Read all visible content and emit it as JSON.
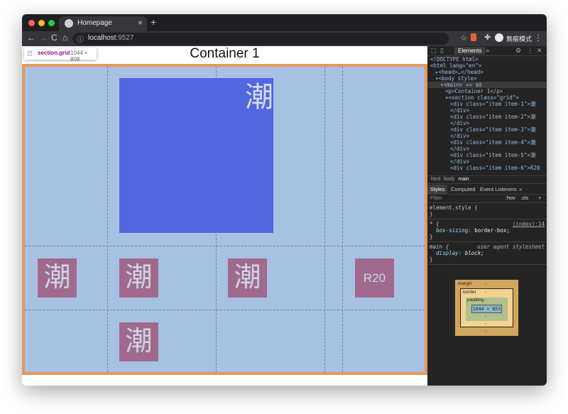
{
  "browser": {
    "tab_title": "Homepage",
    "tab_close": "×",
    "new_tab": "+",
    "nav_back": "←",
    "nav_forward": "→",
    "nav_reload": "C",
    "nav_home": "⌂",
    "url_host": "localhost",
    "url_port": ":9527",
    "bookmark_icon": "☆",
    "profile_label": "無痕模式",
    "menu_icon": "⋮"
  },
  "page": {
    "title": "Container 1",
    "grid_tooltip": {
      "selector": "section.grid",
      "size": "1044 × 808"
    },
    "big_item_char": "潮",
    "small_items": [
      "潮",
      "潮",
      "潮",
      "R20",
      "潮"
    ]
  },
  "devtools": {
    "tabs": {
      "elements": "Elements",
      "more": "»"
    },
    "dom_lines": [
      {
        "indent": 0,
        "text": "<!DOCTYPE html>"
      },
      {
        "indent": 0,
        "text": "<html lang=\"en\">"
      },
      {
        "indent": 1,
        "text": "▸<head>…</head>"
      },
      {
        "indent": 1,
        "text": "▾<body style>"
      },
      {
        "indent": 2,
        "text": "▾<main> == $0"
      },
      {
        "indent": 3,
        "text": "<p>Container 1</p>"
      },
      {
        "indent": 3,
        "text": "▾<section class=\"grid\">"
      },
      {
        "indent": 4,
        "text": "<div class=\"item item-1\">潮"
      },
      {
        "indent": 4,
        "text": "</div>"
      },
      {
        "indent": 4,
        "text": "<div class=\"item item-2\">潮"
      },
      {
        "indent": 4,
        "text": "</div>"
      },
      {
        "indent": 4,
        "text": "<div class=\"item item-3\">潮"
      },
      {
        "indent": 4,
        "text": "</div>"
      },
      {
        "indent": 4,
        "text": "<div class=\"item item-4\">潮"
      },
      {
        "indent": 4,
        "text": "</div>"
      },
      {
        "indent": 4,
        "text": "<div class=\"item item-5\">潮"
      },
      {
        "indent": 4,
        "text": "</div>"
      },
      {
        "indent": 4,
        "text": "<div class=\"item item-6\">R20"
      }
    ],
    "breadcrumb": [
      "html",
      "body",
      "main"
    ],
    "styles_tabs": [
      "Styles",
      "Computed",
      "Event Listeners",
      "»"
    ],
    "filter_placeholder": "Filter",
    "filter_hov": ":hov",
    "filter_cls": ".cls",
    "filter_plus": "+",
    "rules": {
      "element_style_open": "element.style {",
      "element_style_close": "}",
      "star_selector": "* {",
      "star_source": "(index):14",
      "star_prop": "box-sizing",
      "star_val": "border-box;",
      "star_close": "}",
      "main_selector": "main {",
      "main_source": "user agent stylesheet",
      "main_prop": "display",
      "main_val": "block;",
      "main_close": "}"
    },
    "box_model": {
      "margin_label": "margin",
      "margin_value": "-",
      "border_label": "border",
      "border_value": "-",
      "padding_label": "padding",
      "padding_value": "-",
      "content": "1044 × 853",
      "bottom_dash": "-"
    }
  },
  "colors": {
    "grid_background": "#a7c1e2",
    "grid_outline": "#e89857",
    "big_item": "#5067e0",
    "small_item": "#a06a8e",
    "devtools_bg": "#242424"
  }
}
